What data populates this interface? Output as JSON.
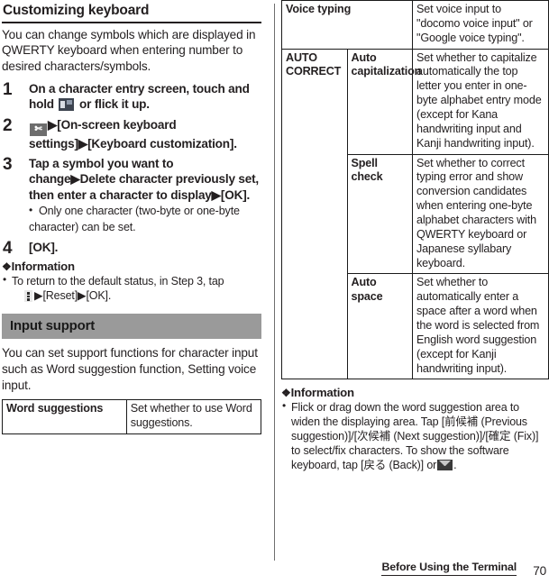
{
  "left": {
    "section_title": "Customizing keyboard",
    "intro": "You can change symbols which are displayed in QWERTY keyboard when entering number to desired characters/symbols.",
    "steps": [
      {
        "num": "1",
        "text_before": "On a character entry screen, touch and hold",
        "icon": "keypad-icon",
        "text_after": "or flick it up."
      },
      {
        "num": "2",
        "icon": "scissors-icon",
        "text_after": "▶[On-screen keyboard settings]▶[Keyboard customization]."
      },
      {
        "num": "3",
        "text_before": "Tap a symbol you want to change▶Delete character previously set, then enter a character to display▶[OK].",
        "substep": "Only one character (two-byte or one-byte character) can be set."
      },
      {
        "num": "4",
        "text_before": "[OK]."
      }
    ],
    "information_heading": "Information",
    "information_items": [
      {
        "line1": "To return to the default status, in Step 3, tap",
        "icon": "kebab-menu-icon",
        "line2": "▶[Reset]▶[OK]."
      }
    ],
    "bar_heading": "Input support",
    "bar_intro": "You can set support functions for character input such as Word suggestion function, Setting voice input.",
    "table": [
      {
        "key": "Word suggestions",
        "value": "Set whether to use Word suggestions."
      }
    ]
  },
  "right": {
    "table": [
      {
        "group": "",
        "key": "Voice typing",
        "value": "Set voice input to \"docomo voice input\" or \"Google voice typing\".",
        "span_key": true
      },
      {
        "group": "AUTO CORRECT",
        "key": "Auto capitalization",
        "value": "Set whether to capitalize automatically the top letter you enter in one-byte alphabet entry mode (except for Kana handwriting input and Kanji handwriting input).",
        "span_key": false
      },
      {
        "group": "",
        "key": "Spell check",
        "value": "Set whether to correct typing error and show conversion candidates when entering one-byte alphabet characters with QWERTY keyboard or Japanese syllabary keyboard.",
        "span_key": false
      },
      {
        "group": "",
        "key": "Auto space",
        "value": "Set whether to automatically enter a space after a word when the word is selected from English word suggestion (except for Kanji handwriting input).",
        "span_key": false
      }
    ],
    "information_heading": "Information",
    "information_text": "Flick or drag down the word suggestion area to widen the displaying area. Tap [前候補 (Previous suggestion)]/[次候補 (Next suggestion)]/[確定 (Fix)] to select/fix characters. To show the software keyboard, tap [戻る (Back)] or",
    "information_text_end": "."
  },
  "footer": {
    "chapter": "Before Using the Terminal",
    "page": "70"
  },
  "group_label": "AUTO CORRECT"
}
